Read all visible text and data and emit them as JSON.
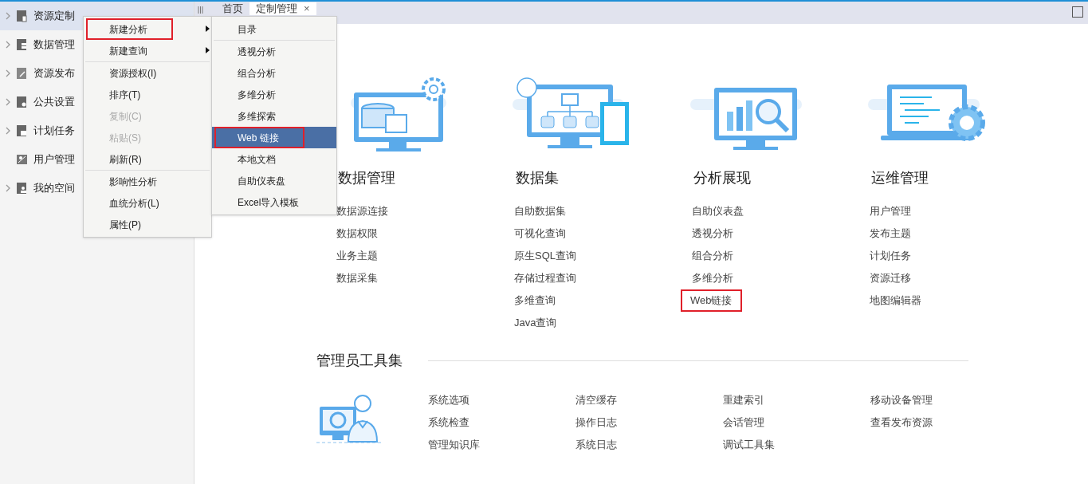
{
  "sidebar": {
    "items": [
      {
        "label": "资源定制",
        "expandable": true,
        "selected": true
      },
      {
        "label": "数据管理",
        "expandable": true,
        "selected": false
      },
      {
        "label": "资源发布",
        "expandable": true,
        "selected": false
      },
      {
        "label": "公共设置",
        "expandable": true,
        "selected": false
      },
      {
        "label": "计划任务",
        "expandable": true,
        "selected": false
      },
      {
        "label": "用户管理",
        "expandable": false,
        "selected": false
      },
      {
        "label": "我的空间",
        "expandable": true,
        "selected": false
      }
    ]
  },
  "tabs": [
    {
      "label": "首页",
      "selected": false,
      "closable": false
    },
    {
      "label": "定制管理",
      "selected": true,
      "closable": true,
      "close": "×"
    }
  ],
  "context_menu": {
    "groups": [
      [
        {
          "label": "新建分析",
          "submenu": true,
          "disabled": false,
          "highlighted": true
        },
        {
          "label": "新建查询",
          "submenu": true,
          "disabled": false,
          "highlighted": false
        }
      ],
      [
        {
          "label": "资源授权(I)",
          "submenu": false,
          "disabled": false,
          "highlighted": false
        },
        {
          "label": "排序(T)",
          "submenu": false,
          "disabled": false,
          "highlighted": false
        },
        {
          "label": "复制(C)",
          "submenu": false,
          "disabled": true,
          "highlighted": false
        },
        {
          "label": "粘贴(S)",
          "submenu": false,
          "disabled": true,
          "highlighted": false
        },
        {
          "label": "刷新(R)",
          "submenu": false,
          "disabled": false,
          "highlighted": false
        }
      ],
      [
        {
          "label": "影响性分析",
          "submenu": false,
          "disabled": false,
          "highlighted": false
        },
        {
          "label": "血统分析(L)",
          "submenu": false,
          "disabled": false,
          "highlighted": false
        },
        {
          "label": "属性(P)",
          "submenu": false,
          "disabled": false,
          "highlighted": false
        }
      ]
    ]
  },
  "submenu": {
    "groups": [
      [
        {
          "label": "目录",
          "selected": false,
          "highlighted": false
        }
      ],
      [
        {
          "label": "透视分析",
          "selected": false,
          "highlighted": false
        },
        {
          "label": "组合分析",
          "selected": false,
          "highlighted": false
        },
        {
          "label": "多维分析",
          "selected": false,
          "highlighted": false
        },
        {
          "label": "多维探索",
          "selected": false,
          "highlighted": false
        },
        {
          "label": "Web 链接",
          "selected": true,
          "highlighted": true
        },
        {
          "label": "本地文档",
          "selected": false,
          "highlighted": false
        },
        {
          "label": "自助仪表盘",
          "selected": false,
          "highlighted": false
        },
        {
          "label": "Excel导入模板",
          "selected": false,
          "highlighted": false
        }
      ]
    ]
  },
  "sections": [
    {
      "title": "数据管理",
      "links": [
        {
          "label": "数据源连接",
          "highlighted": false
        },
        {
          "label": "数据权限",
          "highlighted": false
        },
        {
          "label": "业务主题",
          "highlighted": false
        },
        {
          "label": "数据采集",
          "highlighted": false
        }
      ]
    },
    {
      "title": "数据集",
      "links": [
        {
          "label": "自助数据集",
          "highlighted": false
        },
        {
          "label": "可视化查询",
          "highlighted": false
        },
        {
          "label": "原生SQL查询",
          "highlighted": false
        },
        {
          "label": "存储过程查询",
          "highlighted": false
        },
        {
          "label": "多维查询",
          "highlighted": false
        },
        {
          "label": "Java查询",
          "highlighted": false
        }
      ]
    },
    {
      "title": "分析展现",
      "links": [
        {
          "label": "自助仪表盘",
          "highlighted": false
        },
        {
          "label": "透视分析",
          "highlighted": false
        },
        {
          "label": "组合分析",
          "highlighted": false
        },
        {
          "label": "多维分析",
          "highlighted": false
        },
        {
          "label": "Web链接",
          "highlighted": true
        }
      ]
    },
    {
      "title": "运维管理",
      "links": [
        {
          "label": "用户管理",
          "highlighted": false
        },
        {
          "label": "发布主题",
          "highlighted": false
        },
        {
          "label": "计划任务",
          "highlighted": false
        },
        {
          "label": "资源迁移",
          "highlighted": false
        },
        {
          "label": "地图编辑器",
          "highlighted": false
        }
      ]
    }
  ],
  "admin_tools": {
    "title": "管理员工具集",
    "columns": [
      [
        "系统选项",
        "系统检查",
        "管理知识库"
      ],
      [
        "清空缓存",
        "操作日志",
        "系统日志"
      ],
      [
        "重建索引",
        "会话管理",
        "调试工具集"
      ],
      [
        "移动设备管理",
        "查看发布资源"
      ]
    ]
  }
}
